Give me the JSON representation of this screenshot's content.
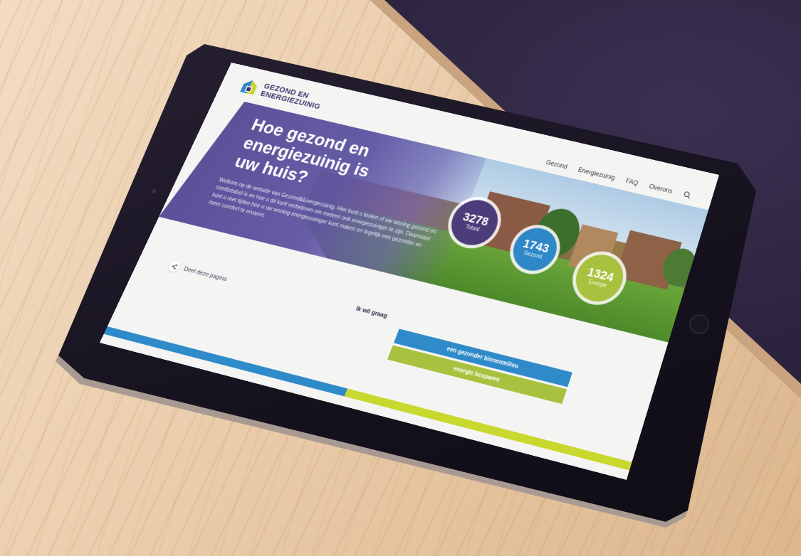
{
  "site": {
    "logo_line1": "GEZOND EN",
    "logo_line2": "ENERGIEZUINIG"
  },
  "nav": {
    "items": [
      "Gezond",
      "Energiezuinig",
      "FAQ",
      "Overons"
    ],
    "search_icon": "search-icon"
  },
  "hero": {
    "title": "Hoe gezond en energiezuinig is uw huis?",
    "text": "Welkom op de website van Gezond&Energiezuinig. Hier kunt u testen of uw woning gezond en comfortabel is en hoe u dit kunt verbeteren om meteen ook energiezuiniger te zijn. Daarnaast kunt u met tijden hoe u uw woning energiezuiniger kunt maken en tegelijk een gezonder en meer comfort te ervaren."
  },
  "stats": [
    {
      "value": "3278",
      "label": "Totaal"
    },
    {
      "value": "1743",
      "label": "Gezond"
    },
    {
      "value": "1324",
      "label": "Energie"
    }
  ],
  "share": {
    "label": "Deel deze pagina",
    "icon": "share-icon"
  },
  "cta": {
    "intro": "Ik wil graag",
    "primary": "een gezonder binnenmilieu",
    "secondary": "energie besparen"
  },
  "colors": {
    "purple": "#5f55a2",
    "blue": "#2f8ac9",
    "green": "#a8c13e",
    "lime": "#c8d82e"
  }
}
